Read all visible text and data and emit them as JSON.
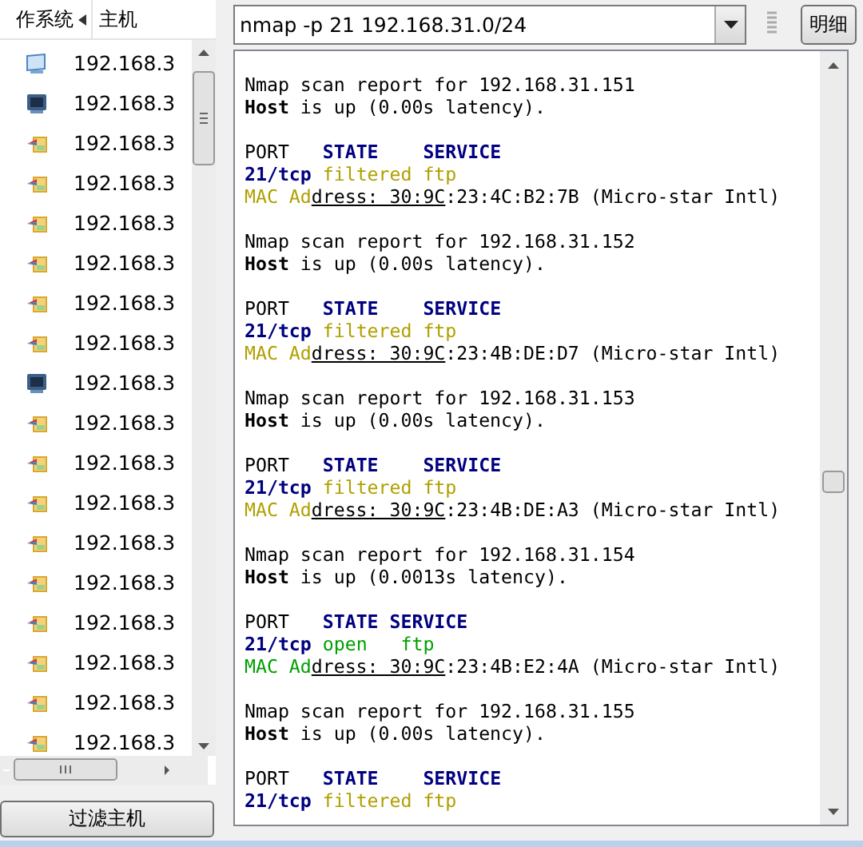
{
  "hosts": {
    "columns": [
      {
        "label": "作系统",
        "sorted": true
      },
      {
        "label": "主机",
        "sorted": false
      }
    ],
    "rows": [
      {
        "kind": "monitor",
        "host": "192.168.3"
      },
      {
        "kind": "dark",
        "host": "192.168.3"
      },
      {
        "kind": "shortcut",
        "host": "192.168.3"
      },
      {
        "kind": "shortcut",
        "host": "192.168.3"
      },
      {
        "kind": "shortcut",
        "host": "192.168.3"
      },
      {
        "kind": "shortcut",
        "host": "192.168.3"
      },
      {
        "kind": "shortcut",
        "host": "192.168.3"
      },
      {
        "kind": "shortcut",
        "host": "192.168.3"
      },
      {
        "kind": "dark",
        "host": "192.168.3"
      },
      {
        "kind": "shortcut",
        "host": "192.168.3"
      },
      {
        "kind": "shortcut",
        "host": "192.168.3"
      },
      {
        "kind": "shortcut",
        "host": "192.168.3"
      },
      {
        "kind": "shortcut",
        "host": "192.168.3"
      },
      {
        "kind": "shortcut",
        "host": "192.168.3"
      },
      {
        "kind": "shortcut",
        "host": "192.168.3"
      },
      {
        "kind": "shortcut",
        "host": "192.168.3"
      },
      {
        "kind": "shortcut",
        "host": "192.168.3"
      },
      {
        "kind": "shortcut",
        "host": "192.168.3"
      }
    ],
    "filter_button": "过滤主机"
  },
  "command": {
    "value": "nmap -p 21 192.168.31.0/24",
    "details_button": "明细"
  },
  "output": [
    [
      [
        {
          "kind": "plain",
          "text": "Nmap scan report for 192.168.31.151"
        }
      ],
      [
        {
          "kind": "bold",
          "text": "Host"
        },
        {
          "kind": "plain",
          "text": " is up (0.00s latency)."
        }
      ]
    ],
    [
      [
        {
          "kind": "plain",
          "text": "PORT   "
        },
        {
          "kind": "head",
          "text": "STATE    SERVICE"
        }
      ],
      [
        {
          "kind": "port",
          "text": "21/tcp "
        },
        {
          "kind": "filtered",
          "text": "filtered ftp"
        }
      ],
      [
        {
          "kind": "filtered",
          "text": "MAC Ad"
        },
        {
          "kind": "link",
          "text": "dress: 30:9C"
        },
        {
          "kind": "plain",
          "text": ":23:4C:B2:7B (Micro-star Intl)"
        }
      ]
    ],
    [
      [
        {
          "kind": "plain",
          "text": "Nmap scan report for 192.168.31.152"
        }
      ],
      [
        {
          "kind": "bold",
          "text": "Host"
        },
        {
          "kind": "plain",
          "text": " is up (0.00s latency)."
        }
      ]
    ],
    [
      [
        {
          "kind": "plain",
          "text": "PORT   "
        },
        {
          "kind": "head",
          "text": "STATE    SERVICE"
        }
      ],
      [
        {
          "kind": "port",
          "text": "21/tcp "
        },
        {
          "kind": "filtered",
          "text": "filtered ftp"
        }
      ],
      [
        {
          "kind": "filtered",
          "text": "MAC Ad"
        },
        {
          "kind": "link",
          "text": "dress: 30:9C"
        },
        {
          "kind": "plain",
          "text": ":23:4B:DE:D7 (Micro-star Intl)"
        }
      ]
    ],
    [
      [
        {
          "kind": "plain",
          "text": "Nmap scan report for 192.168.31.153"
        }
      ],
      [
        {
          "kind": "bold",
          "text": "Host"
        },
        {
          "kind": "plain",
          "text": " is up (0.00s latency)."
        }
      ]
    ],
    [
      [
        {
          "kind": "plain",
          "text": "PORT   "
        },
        {
          "kind": "head",
          "text": "STATE    SERVICE"
        }
      ],
      [
        {
          "kind": "port",
          "text": "21/tcp "
        },
        {
          "kind": "filtered",
          "text": "filtered ftp"
        }
      ],
      [
        {
          "kind": "filtered",
          "text": "MAC Ad"
        },
        {
          "kind": "link",
          "text": "dress: 30:9C"
        },
        {
          "kind": "plain",
          "text": ":23:4B:DE:A3 (Micro-star Intl)"
        }
      ]
    ],
    [
      [
        {
          "kind": "plain",
          "text": "Nmap scan report for 192.168.31.154"
        }
      ],
      [
        {
          "kind": "bold",
          "text": "Host"
        },
        {
          "kind": "plain",
          "text": " is up (0.0013s latency)."
        }
      ]
    ],
    [
      [
        {
          "kind": "plain",
          "text": "PORT   "
        },
        {
          "kind": "head",
          "text": "STATE SERVICE"
        }
      ],
      [
        {
          "kind": "port",
          "text": "21/tcp "
        },
        {
          "kind": "open",
          "text": "open   ftp"
        }
      ],
      [
        {
          "kind": "open",
          "text": "MAC Ad"
        },
        {
          "kind": "link",
          "text": "dress: 30:9C"
        },
        {
          "kind": "plain",
          "text": ":23:4B:E2:4A (Micro-star Intl)"
        }
      ]
    ],
    [
      [
        {
          "kind": "plain",
          "text": "Nmap scan report for 192.168.31.155"
        }
      ],
      [
        {
          "kind": "bold",
          "text": "Host"
        },
        {
          "kind": "plain",
          "text": " is up (0.00s latency)."
        }
      ]
    ],
    [
      [
        {
          "kind": "plain",
          "text": "PORT   "
        },
        {
          "kind": "head",
          "text": "STATE    SERVICE"
        }
      ],
      [
        {
          "kind": "port",
          "text": "21/tcp "
        },
        {
          "kind": "filtered",
          "text": "filtered ftp"
        }
      ]
    ]
  ]
}
